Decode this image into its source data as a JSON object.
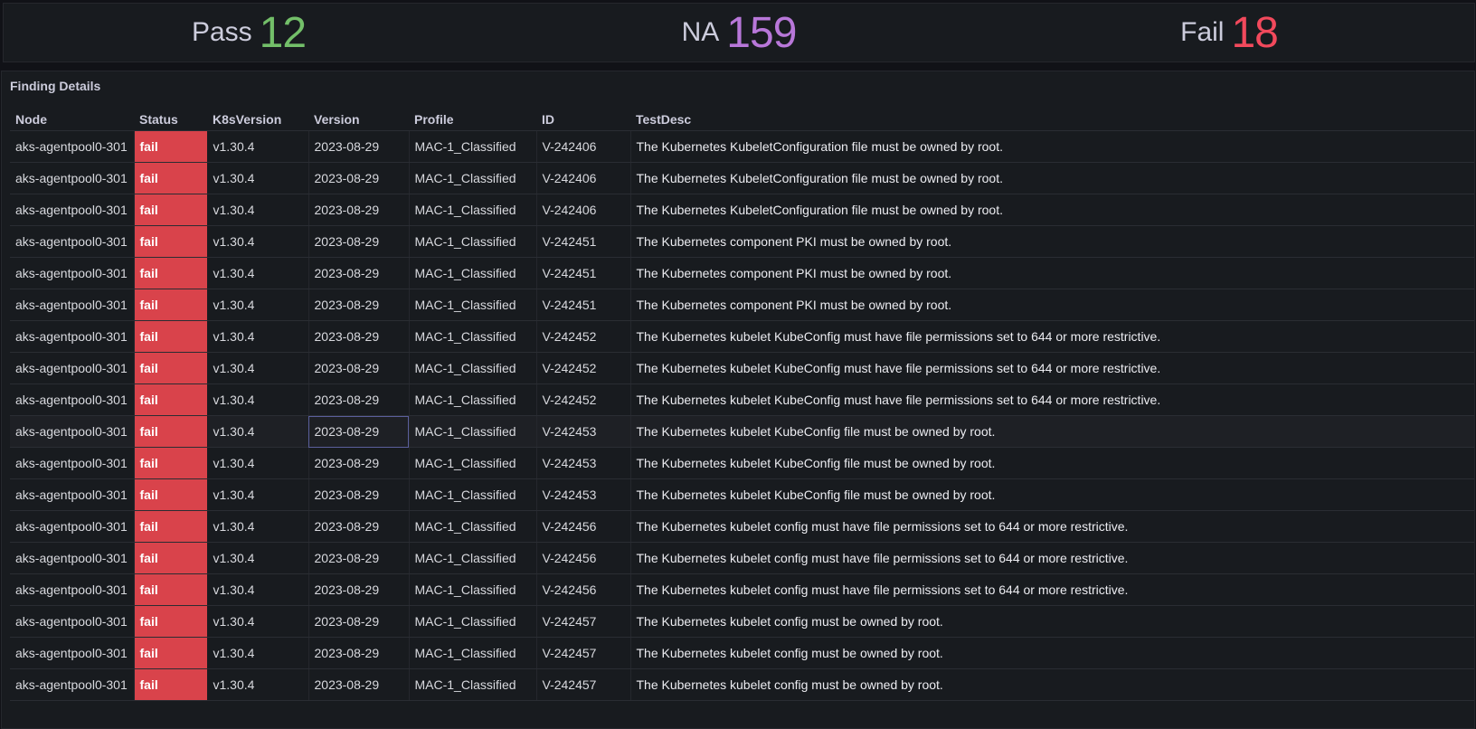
{
  "stats": {
    "pass": {
      "label": "Pass",
      "value": "12",
      "color": "#73bf69"
    },
    "na": {
      "label": "NA",
      "value": "159",
      "color": "#b877d9"
    },
    "fail": {
      "label": "Fail",
      "value": "18",
      "color": "#f2495c"
    }
  },
  "table": {
    "title": "Finding Details",
    "columns": [
      "Node",
      "Status",
      "K8sVersion",
      "Version",
      "Profile",
      "ID",
      "TestDesc"
    ],
    "rows": [
      [
        "aks-agentpool0-301",
        "fail",
        "v1.30.4",
        "2023-08-29",
        "MAC-1_Classified",
        "V-242406",
        "The Kubernetes KubeletConfiguration file must be owned by root."
      ],
      [
        "aks-agentpool0-301",
        "fail",
        "v1.30.4",
        "2023-08-29",
        "MAC-1_Classified",
        "V-242406",
        "The Kubernetes KubeletConfiguration file must be owned by root."
      ],
      [
        "aks-agentpool0-301",
        "fail",
        "v1.30.4",
        "2023-08-29",
        "MAC-1_Classified",
        "V-242406",
        "The Kubernetes KubeletConfiguration file must be owned by root."
      ],
      [
        "aks-agentpool0-301",
        "fail",
        "v1.30.4",
        "2023-08-29",
        "MAC-1_Classified",
        "V-242451",
        "The Kubernetes component PKI must be owned by root."
      ],
      [
        "aks-agentpool0-301",
        "fail",
        "v1.30.4",
        "2023-08-29",
        "MAC-1_Classified",
        "V-242451",
        "The Kubernetes component PKI must be owned by root."
      ],
      [
        "aks-agentpool0-301",
        "fail",
        "v1.30.4",
        "2023-08-29",
        "MAC-1_Classified",
        "V-242451",
        "The Kubernetes component PKI must be owned by root."
      ],
      [
        "aks-agentpool0-301",
        "fail",
        "v1.30.4",
        "2023-08-29",
        "MAC-1_Classified",
        "V-242452",
        "The Kubernetes kubelet KubeConfig must have file permissions set to 644 or more restrictive."
      ],
      [
        "aks-agentpool0-301",
        "fail",
        "v1.30.4",
        "2023-08-29",
        "MAC-1_Classified",
        "V-242452",
        "The Kubernetes kubelet KubeConfig must have file permissions set to 644 or more restrictive."
      ],
      [
        "aks-agentpool0-301",
        "fail",
        "v1.30.4",
        "2023-08-29",
        "MAC-1_Classified",
        "V-242452",
        "The Kubernetes kubelet KubeConfig must have file permissions set to 644 or more restrictive."
      ],
      [
        "aks-agentpool0-301",
        "fail",
        "v1.30.4",
        "2023-08-29",
        "MAC-1_Classified",
        "V-242453",
        "The Kubernetes kubelet KubeConfig file must be owned by root."
      ],
      [
        "aks-agentpool0-301",
        "fail",
        "v1.30.4",
        "2023-08-29",
        "MAC-1_Classified",
        "V-242453",
        "The Kubernetes kubelet KubeConfig file must be owned by root."
      ],
      [
        "aks-agentpool0-301",
        "fail",
        "v1.30.4",
        "2023-08-29",
        "MAC-1_Classified",
        "V-242453",
        "The Kubernetes kubelet KubeConfig file must be owned by root."
      ],
      [
        "aks-agentpool0-301",
        "fail",
        "v1.30.4",
        "2023-08-29",
        "MAC-1_Classified",
        "V-242456",
        "The Kubernetes kubelet config must have file permissions set to 644 or more restrictive."
      ],
      [
        "aks-agentpool0-301",
        "fail",
        "v1.30.4",
        "2023-08-29",
        "MAC-1_Classified",
        "V-242456",
        "The Kubernetes kubelet config must have file permissions set to 644 or more restrictive."
      ],
      [
        "aks-agentpool0-301",
        "fail",
        "v1.30.4",
        "2023-08-29",
        "MAC-1_Classified",
        "V-242456",
        "The Kubernetes kubelet config must have file permissions set to 644 or more restrictive."
      ],
      [
        "aks-agentpool0-301",
        "fail",
        "v1.30.4",
        "2023-08-29",
        "MAC-1_Classified",
        "V-242457",
        "The Kubernetes kubelet config must be owned by root."
      ],
      [
        "aks-agentpool0-301",
        "fail",
        "v1.30.4",
        "2023-08-29",
        "MAC-1_Classified",
        "V-242457",
        "The Kubernetes kubelet config must be owned by root."
      ],
      [
        "aks-agentpool0-301",
        "fail",
        "v1.30.4",
        "2023-08-29",
        "MAC-1_Classified",
        "V-242457",
        "The Kubernetes kubelet config must be owned by root."
      ]
    ]
  }
}
